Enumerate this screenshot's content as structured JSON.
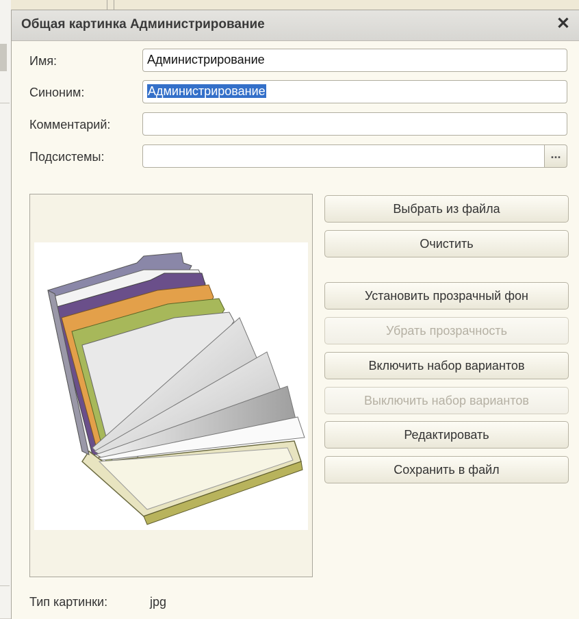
{
  "window": {
    "title": "Общая картинка Администрирование",
    "close_symbol": "✕"
  },
  "form": {
    "name_label": "Имя:",
    "name_value": "Администрирование",
    "synonym_label": "Синоним:",
    "synonym_value": "Администрирование",
    "comment_label": "Комментарий:",
    "comment_value": "",
    "subsystems_label": "Подсистемы:",
    "subsystems_value": "",
    "subsystems_button": "..."
  },
  "picture": {
    "icon": "folder-tabs-image",
    "type_label": "Тип картинки:",
    "type_value": "jpg"
  },
  "buttons": {
    "choose_from_file": "Выбрать из файла",
    "clear": "Очистить",
    "set_transparent": "Установить прозрачный фон",
    "remove_transparency": "Убрать прозрачность",
    "enable_variants": "Включить набор вариантов",
    "disable_variants": "Выключить набор вариантов",
    "edit": "Редактировать",
    "save_to_file": "Сохранить в файл"
  },
  "colors": {
    "selection": "#3470c9",
    "window_bg": "#fbf9ef",
    "disabled_text": "#b5b0a3"
  }
}
